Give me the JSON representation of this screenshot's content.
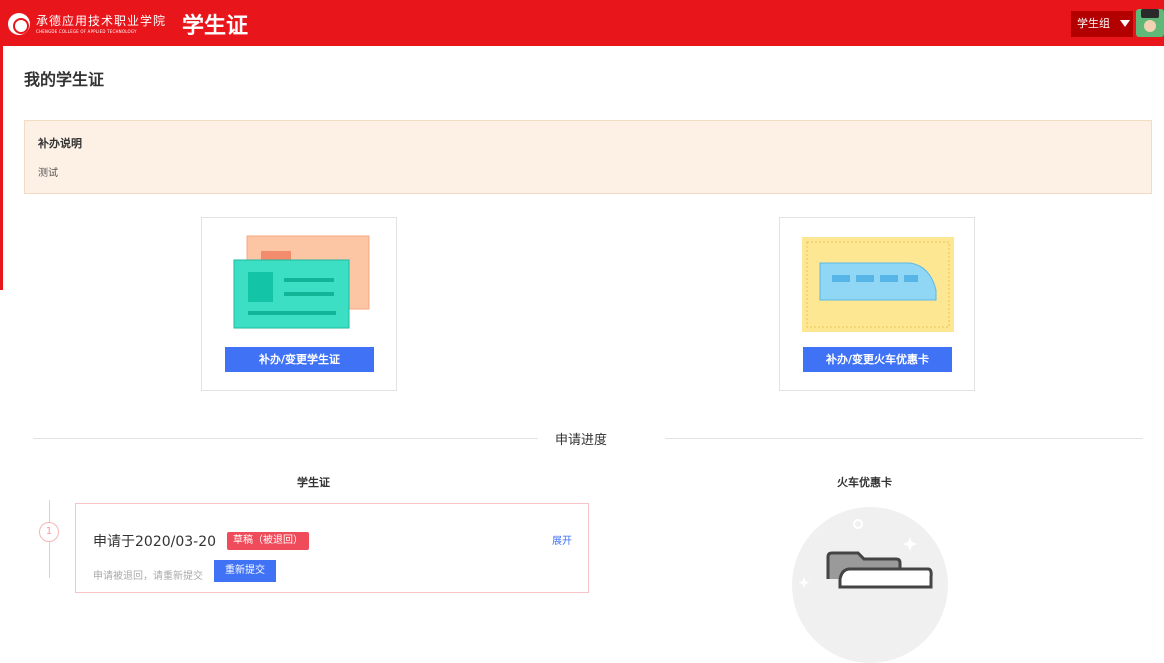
{
  "header": {
    "college_name_cn": "承德应用技术职业学院",
    "college_name_en": "CHENGDE COLLEGE OF APPLIED TECHNOLOGY",
    "app_title": "学生证",
    "user_role": "学生组",
    "brand_color": "#e8151b"
  },
  "page": {
    "title": "我的学生证"
  },
  "notice": {
    "title": "补办说明",
    "body": "测试"
  },
  "cards": [
    {
      "button_label": "补办/变更学生证",
      "icon": "id-card-illustration"
    },
    {
      "button_label": "补办/变更火车优惠卡",
      "icon": "train-card-illustration"
    }
  ],
  "progress": {
    "section_title": "申请进度",
    "columns": [
      "学生证",
      "火车优惠卡"
    ],
    "applications": [
      {
        "step": "1",
        "date_text": "申请于2020/03-20",
        "status": "草稿（被退回）",
        "expand_label": "展开",
        "message": "申请被退回，请重新提交",
        "resubmit_label": "重新提交"
      }
    ],
    "empty_icon": "empty-folder-icon"
  }
}
